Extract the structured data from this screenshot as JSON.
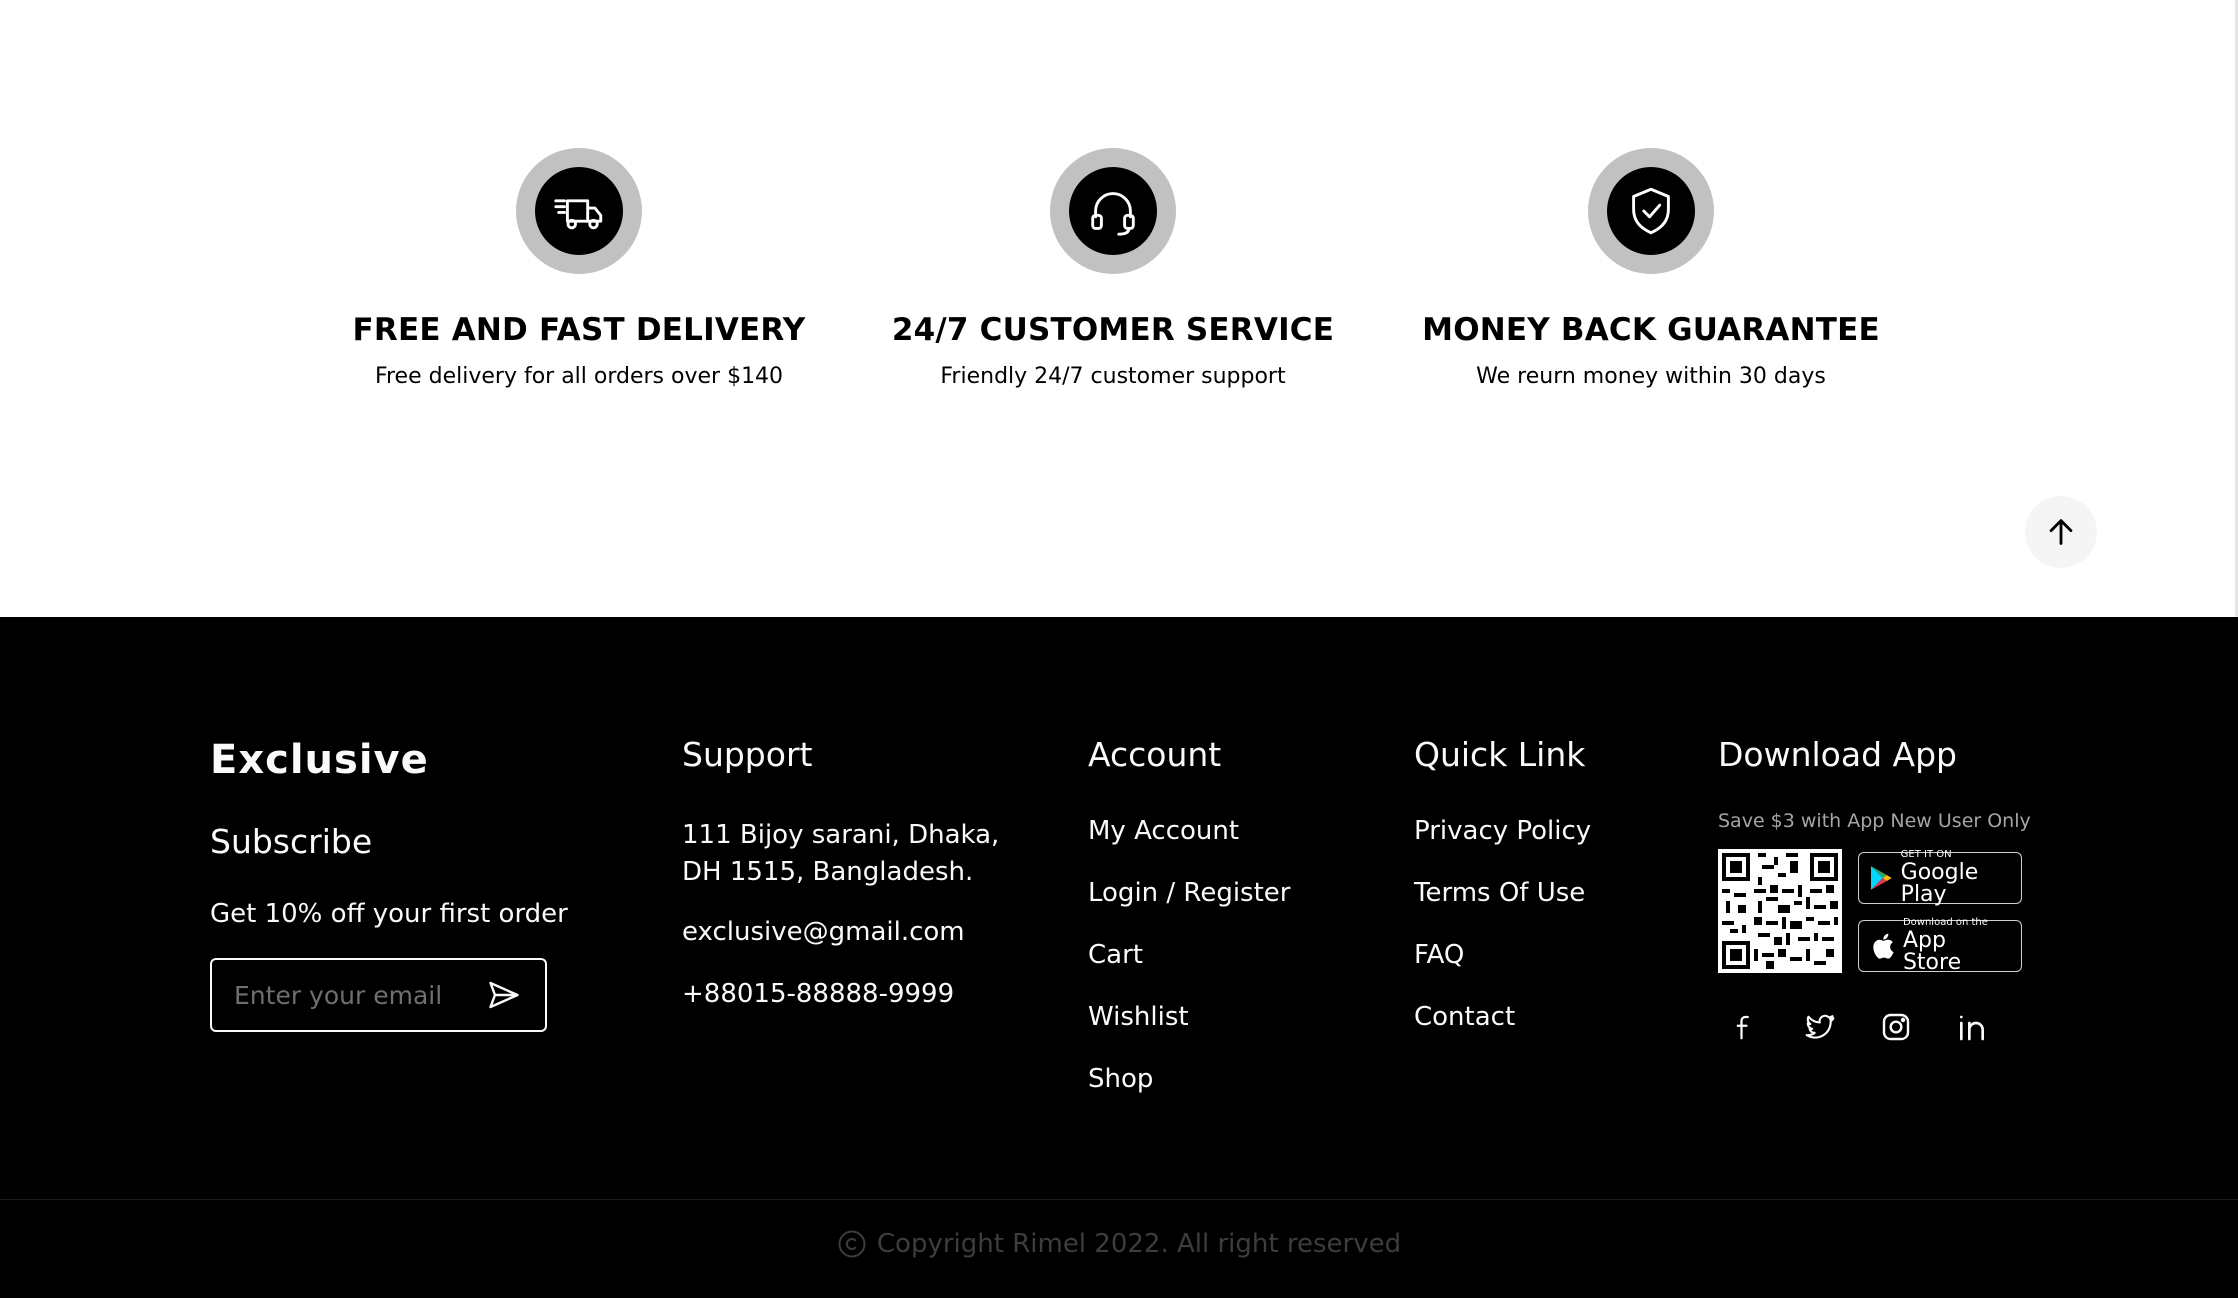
{
  "features": [
    {
      "icon": "delivery-truck-icon",
      "title": "FREE AND FAST DELIVERY",
      "text": "Free delivery for all orders over $140"
    },
    {
      "icon": "headphones-icon",
      "title": "24/7 CUSTOMER SERVICE",
      "text": "Friendly 24/7 customer support"
    },
    {
      "icon": "shield-check-icon",
      "title": "MONEY BACK GUARANTEE",
      "text": "We reurn money within 30 days"
    }
  ],
  "footer": {
    "brand": "Exclusive",
    "subscribe": {
      "title": "Subscribe",
      "offer": "Get 10% off your first order",
      "email_placeholder": "Enter your email"
    },
    "support": {
      "title": "Support",
      "address_line1": "111 Bijoy sarani, Dhaka,",
      "address_line2": "DH 1515, Bangladesh.",
      "email": "exclusive@gmail.com",
      "phone": "+88015-88888-9999"
    },
    "account": {
      "title": "Account",
      "items": [
        "My Account",
        "Login / Register",
        "Cart",
        "Wishlist",
        "Shop"
      ]
    },
    "quick_link": {
      "title": "Quick Link",
      "items": [
        "Privacy Policy",
        "Terms Of Use",
        "FAQ",
        "Contact"
      ]
    },
    "download": {
      "title": "Download App",
      "note": "Save $3 with App New User Only",
      "google_small": "GET IT ON",
      "google_big": "Google Play",
      "apple_small": "Download on the",
      "apple_big": "App Store"
    },
    "copyright": "Copyright Rimel 2022. All right reserved"
  },
  "colors": {
    "footer_bg": "#000000",
    "icon_ring": "#c1c1c1",
    "muted_text": "#3d3d3d"
  }
}
